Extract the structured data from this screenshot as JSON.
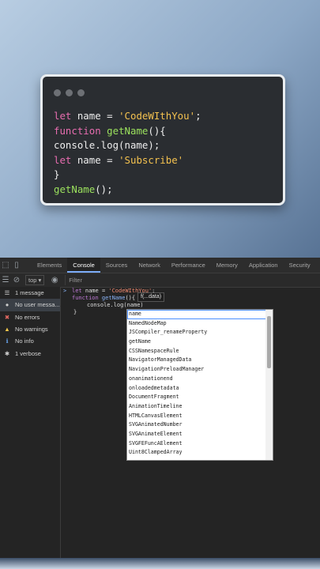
{
  "card": {
    "lines": [
      [
        {
          "t": "let",
          "c": "kw"
        },
        {
          "t": " name = ",
          "c": "plain"
        },
        {
          "t": "'CodeWIthYou'",
          "c": "str"
        },
        {
          "t": ";",
          "c": "plain"
        }
      ],
      [
        {
          "t": "function",
          "c": "kw"
        },
        {
          "t": " getName",
          "c": "fn"
        },
        {
          "t": "(){",
          "c": "plain"
        }
      ],
      [
        {
          "t": "console.log(name);",
          "c": "plain"
        }
      ],
      [
        {
          "t": "let",
          "c": "kw"
        },
        {
          "t": " name = ",
          "c": "plain"
        },
        {
          "t": "'Subscribe'",
          "c": "str"
        }
      ],
      [
        {
          "t": "}",
          "c": "plain"
        }
      ],
      [
        {
          "t": "getName",
          "c": "fn"
        },
        {
          "t": "();",
          "c": "plain"
        }
      ]
    ]
  },
  "devtools": {
    "tabs": [
      "Elements",
      "Console",
      "Sources",
      "Network",
      "Performance",
      "Memory",
      "Application",
      "Security"
    ],
    "active_tab": "Console",
    "context": "top",
    "filter_placeholder": "Filter",
    "sidebar": [
      {
        "label": "1 message",
        "icon": "list-icon",
        "color": "#cfcfcf"
      },
      {
        "label": "No user messa...",
        "icon": "user-icon",
        "color": "#cfcfcf"
      },
      {
        "label": "No errors",
        "icon": "error-icon",
        "color": "#e46962"
      },
      {
        "label": "No warnings",
        "icon": "warning-icon",
        "color": "#f2c94c"
      },
      {
        "label": "No info",
        "icon": "info-icon",
        "color": "#6aa9f5"
      },
      {
        "label": "1 verbose",
        "icon": "gear-icon",
        "color": "#cfcfcf"
      }
    ],
    "console_lines": {
      "prompt": ">",
      "line1_kw": "let",
      "line1_mid": " name = ",
      "line1_str": "'CodeWIthYou'",
      "line1_end": ";",
      "line2_kw": "function",
      "line2_fn": " getName",
      "line2_end": "(){",
      "line3": "console.log(name)",
      "line4": "}",
      "tooltip": "f(...data)"
    },
    "autocomplete": [
      "name",
      "NamedNodeMap",
      "JSCompiler_renameProperty",
      "getName",
      "CSSNamespaceRule",
      "NavigatorManagedData",
      "NavigationPreloadManager",
      "onanimationend",
      "onloadedmetadata",
      "DocumentFragment",
      "AnimationTimeline",
      "HTMLCanvasElement",
      "SVGAnimatedNumber",
      "SVGAnimateElement",
      "SVGFEFuncAElement",
      "Uint8ClampedArray"
    ]
  }
}
